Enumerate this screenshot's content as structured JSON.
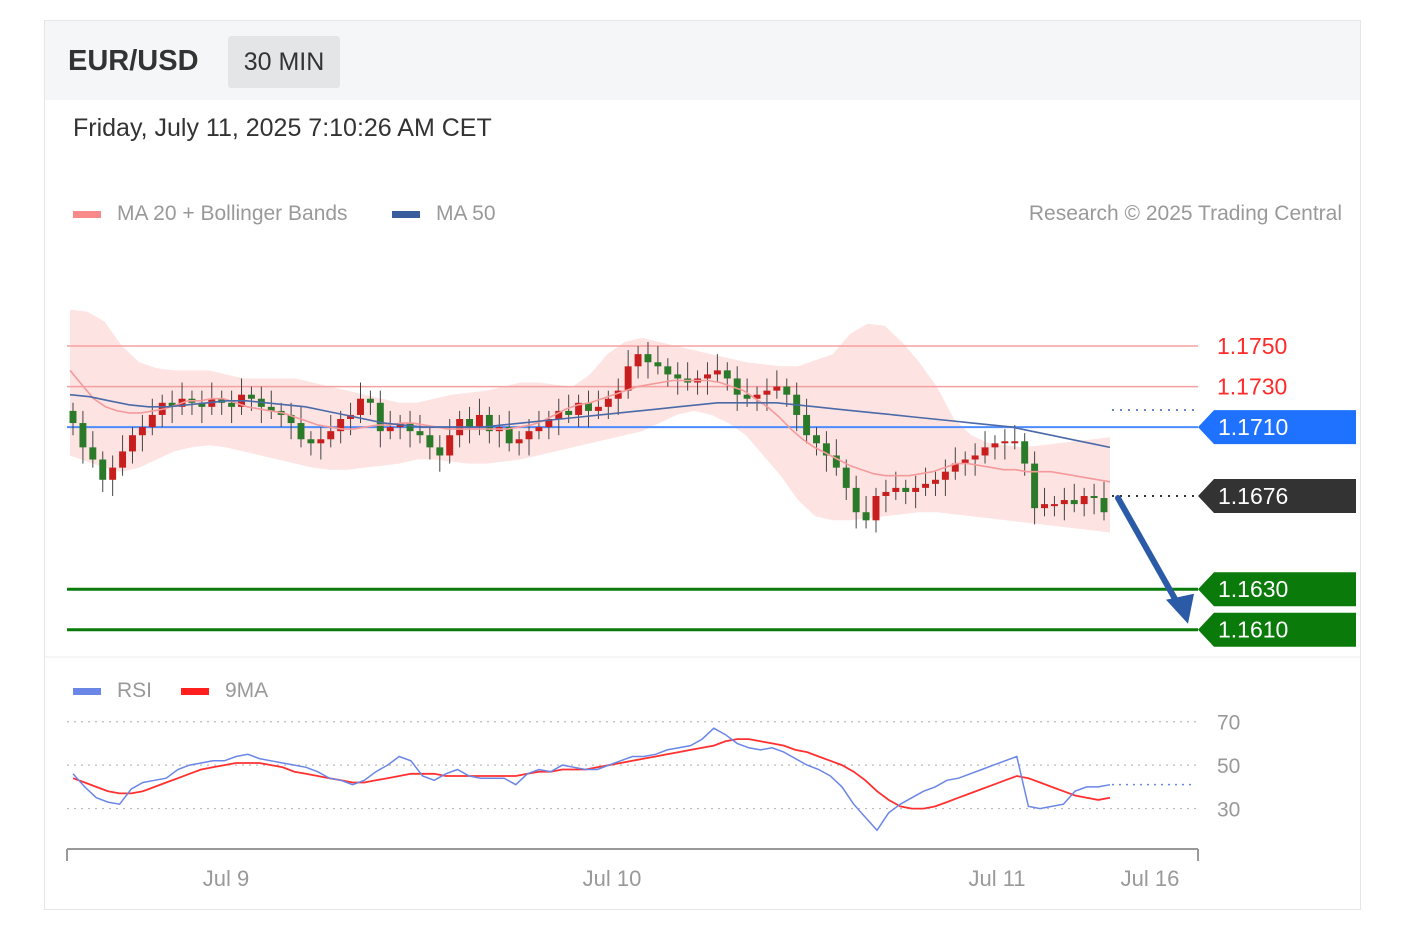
{
  "header": {
    "pair": "EUR/USD",
    "timeframe": "30 MIN"
  },
  "timestamp": "Friday, July 11, 2025 7:10:26 AM CET",
  "legend_main": [
    {
      "label": "MA 20 + Bollinger Bands",
      "color": "#f88a8a"
    },
    {
      "label": "MA 50",
      "color": "#3a5e9c"
    }
  ],
  "credit": "Research © 2025 Trading Central",
  "legend_rsi": [
    {
      "label": "RSI",
      "color": "#6a86e6"
    },
    {
      "label": "9MA",
      "color": "#ff1f1f"
    }
  ],
  "chart_data": [
    {
      "type": "candlestick",
      "ylim": [
        1.16,
        1.179
      ],
      "x_ticks": [
        "Jul 9",
        "Jul 10",
        "Jul 11",
        "Jul 16"
      ],
      "resistance": [
        {
          "label": "1.1750",
          "value": 1.175,
          "color": "#ff2a2a"
        },
        {
          "label": "1.1730",
          "value": 1.173,
          "color": "#ff2a2a"
        }
      ],
      "pivot": {
        "label": "1.1710",
        "value": 1.171,
        "color": "#1e72ff"
      },
      "last_price": {
        "label": "1.1676",
        "value": 1.1676,
        "color": "#333333"
      },
      "supports": [
        {
          "label": "1.1630",
          "value": 1.163,
          "color": "#0a7a0a"
        },
        {
          "label": "1.1610",
          "value": 1.161,
          "color": "#0a7a0a"
        }
      ],
      "arrow": {
        "from": 1.1676,
        "to": 1.161,
        "color": "#2b5aa6"
      },
      "close": [
        1.1712,
        1.17,
        1.1694,
        1.1684,
        1.169,
        1.1698,
        1.1706,
        1.171,
        1.1716,
        1.1722,
        1.172,
        1.1724,
        1.1722,
        1.172,
        1.1724,
        1.1722,
        1.172,
        1.1726,
        1.1724,
        1.172,
        1.1718,
        1.1716,
        1.1712,
        1.1704,
        1.1702,
        1.1704,
        1.1708,
        1.1714,
        1.1716,
        1.1724,
        1.1722,
        1.1708,
        1.171,
        1.1712,
        1.1708,
        1.1706,
        1.17,
        1.1696,
        1.1706,
        1.1714,
        1.171,
        1.1716,
        1.1708,
        1.171,
        1.1702,
        1.1704,
        1.1708,
        1.171,
        1.1714,
        1.1718,
        1.1716,
        1.1722,
        1.1718,
        1.172,
        1.1724,
        1.1728,
        1.174,
        1.1746,
        1.1742,
        1.174,
        1.1736,
        1.1734,
        1.1732,
        1.1734,
        1.1736,
        1.1738,
        1.1734,
        1.1726,
        1.1724,
        1.1726,
        1.1728,
        1.173,
        1.1726,
        1.1716,
        1.1706,
        1.1702,
        1.1696,
        1.169,
        1.168,
        1.1668,
        1.1664,
        1.1676,
        1.1678,
        1.168,
        1.1678,
        1.168,
        1.1682,
        1.1684,
        1.1688,
        1.1692,
        1.1694,
        1.1696,
        1.17,
        1.1702,
        1.1703,
        1.1703,
        1.1692,
        1.167,
        1.1672,
        1.1672,
        1.1674,
        1.1672,
        1.1676,
        1.1675,
        1.1668
      ],
      "ma20": [
        1.1738,
        1.1731,
        1.1724,
        1.172,
        1.1718,
        1.1717,
        1.1717,
        1.1718,
        1.1719,
        1.1721,
        1.1723,
        1.1723,
        1.1724,
        1.1724,
        1.1722,
        1.172,
        1.1719,
        1.1718,
        1.1717,
        1.1715,
        1.1713,
        1.1711,
        1.171,
        1.1709,
        1.1709,
        1.171,
        1.1711,
        1.1711,
        1.1712,
        1.1712,
        1.1711,
        1.171,
        1.1709,
        1.1709,
        1.1709,
        1.1709,
        1.1709,
        1.1709,
        1.171,
        1.1711,
        1.1713,
        1.1716,
        1.1719,
        1.1721,
        1.1722,
        1.1724,
        1.1726,
        1.1728,
        1.173,
        1.1731,
        1.1732,
        1.1733,
        1.1733,
        1.1733,
        1.1733,
        1.1732,
        1.173,
        1.1728,
        1.1724,
        1.172,
        1.1715,
        1.1709,
        1.1704,
        1.17,
        1.1697,
        1.1694,
        1.1691,
        1.1689,
        1.1687,
        1.1686,
        1.1686,
        1.1686,
        1.1687,
        1.1688,
        1.169,
        1.1692,
        1.1692,
        1.1691,
        1.169,
        1.1689,
        1.1689,
        1.1688,
        1.1688,
        1.1688,
        1.1687,
        1.1686,
        1.1685,
        1.1684,
        1.1683
      ],
      "bb_upper": [
        1.1768,
        1.1767,
        1.1762,
        1.175,
        1.1742,
        1.1739,
        1.1738,
        1.1738,
        1.1738,
        1.1736,
        1.1734,
        1.1734,
        1.1734,
        1.1734,
        1.1732,
        1.173,
        1.1728,
        1.1726,
        1.1724,
        1.1722,
        1.1722,
        1.1724,
        1.1726,
        1.1727,
        1.1728,
        1.173,
        1.1732,
        1.1732,
        1.1731,
        1.173,
        1.1736,
        1.1746,
        1.1752,
        1.1754,
        1.1752,
        1.175,
        1.1748,
        1.1746,
        1.1744,
        1.1742,
        1.1741,
        1.174,
        1.174,
        1.1743,
        1.1746,
        1.1756,
        1.1761,
        1.176,
        1.1752,
        1.1742,
        1.173,
        1.1714,
        1.1706,
        1.1702,
        1.1701,
        1.17,
        1.1701,
        1.1702,
        1.1703,
        1.1704,
        1.1705
      ],
      "bb_lower": [
        1.1696,
        1.1693,
        1.169,
        1.1688,
        1.169,
        1.1694,
        1.1698,
        1.17,
        1.1701,
        1.17,
        1.1698,
        1.1696,
        1.1694,
        1.1692,
        1.169,
        1.1689,
        1.1689,
        1.169,
        1.1691,
        1.1692,
        1.1694,
        1.1694,
        1.1693,
        1.1692,
        1.1692,
        1.1693,
        1.1694,
        1.1696,
        1.1698,
        1.17,
        1.1702,
        1.1704,
        1.1706,
        1.1708,
        1.1712,
        1.1716,
        1.1718,
        1.1716,
        1.1712,
        1.1706,
        1.1696,
        1.1686,
        1.1674,
        1.1666,
        1.1664,
        1.1664,
        1.1665,
        1.1666,
        1.1667,
        1.1668,
        1.1668,
        1.1667,
        1.1666,
        1.1665,
        1.1664,
        1.1663,
        1.1662,
        1.1661,
        1.166,
        1.1659,
        1.1658
      ],
      "ma50": [
        1.1726,
        1.1725,
        1.1723,
        1.1721,
        1.172,
        1.172,
        1.1721,
        1.1722,
        1.1723,
        1.1723,
        1.1722,
        1.1721,
        1.172,
        1.1718,
        1.1716,
        1.1714,
        1.1712,
        1.1711,
        1.171,
        1.171,
        1.171,
        1.171,
        1.1711,
        1.1712,
        1.1713,
        1.1714,
        1.1715,
        1.1716,
        1.1717,
        1.1718,
        1.1719,
        1.172,
        1.1721,
        1.1722,
        1.1722,
        1.1722,
        1.1722,
        1.1721,
        1.172,
        1.1719,
        1.1718,
        1.1717,
        1.1716,
        1.1715,
        1.1714,
        1.1713,
        1.1712,
        1.1711,
        1.171,
        1.1708,
        1.1706,
        1.1704,
        1.1702,
        1.17
      ]
    },
    {
      "type": "line",
      "ylim": [
        10,
        80
      ],
      "y_ticks": [
        "70",
        "50",
        "30"
      ],
      "series": [
        {
          "name": "RSI",
          "values": [
            46,
            40,
            35,
            33,
            32,
            39,
            42,
            43,
            44,
            48,
            50,
            51,
            52,
            52,
            54,
            55,
            53,
            52,
            51,
            50,
            49,
            47,
            44,
            43,
            41,
            43,
            47,
            50,
            54,
            52,
            45,
            43,
            46,
            48,
            45,
            44,
            44,
            44,
            41,
            46,
            48,
            47,
            50,
            49,
            48,
            48,
            50,
            52,
            54,
            54,
            55,
            57,
            58,
            59,
            62,
            67,
            64,
            60,
            58,
            57,
            58,
            56,
            53,
            50,
            48,
            45,
            40,
            32,
            26,
            20,
            28,
            32,
            35,
            38,
            40,
            43,
            44,
            46,
            48,
            50,
            52,
            54,
            31,
            30,
            31,
            32,
            38,
            40,
            40,
            41
          ]
        },
        {
          "name": "9MA",
          "values": [
            44,
            42,
            40,
            38,
            37,
            37,
            38,
            40,
            42,
            44,
            46,
            48,
            49,
            50,
            51,
            51,
            51,
            50,
            49,
            47,
            46,
            45,
            44,
            43,
            42,
            42,
            43,
            44,
            45,
            46,
            46,
            46,
            45,
            45,
            45,
            45,
            45,
            45,
            45,
            46,
            47,
            47,
            48,
            48,
            48,
            49,
            50,
            51,
            52,
            53,
            54,
            55,
            56,
            57,
            58,
            59,
            61,
            62,
            62,
            61,
            60,
            59,
            57,
            56,
            54,
            52,
            50,
            47,
            43,
            38,
            34,
            31,
            30,
            30,
            31,
            33,
            35,
            37,
            39,
            41,
            43,
            45,
            44,
            42,
            40,
            38,
            36,
            35,
            34,
            35
          ]
        }
      ]
    }
  ]
}
